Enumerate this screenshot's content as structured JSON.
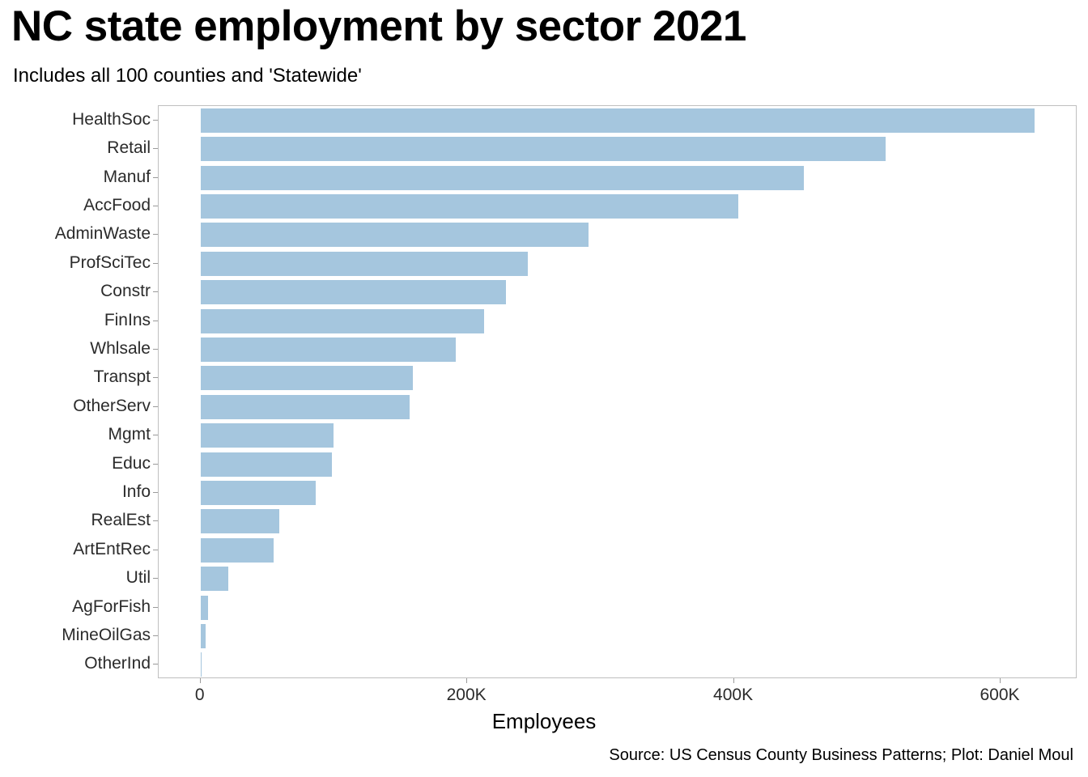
{
  "header": {
    "title": "NC state employment by sector 2021",
    "subtitle": "Includes all 100 counties and 'Statewide'"
  },
  "footer": {
    "caption": "Source: US Census County Business Patterns; Plot: Daniel Moul"
  },
  "axes": {
    "x_title": "Employees",
    "x_ticks": [
      {
        "label": "0",
        "value": 0
      },
      {
        "label": "200K",
        "value": 200000
      },
      {
        "label": "400K",
        "value": 400000
      },
      {
        "label": "600K",
        "value": 600000
      }
    ]
  },
  "style": {
    "bar_color": "#a5c6de",
    "panel_border": "#bfbfbf",
    "axis_text": "#2b2b2b",
    "background": "#ffffff"
  },
  "chart_data": {
    "type": "bar",
    "orientation": "horizontal",
    "title": "NC state employment by sector 2021",
    "subtitle": "Includes all 100 counties and 'Statewide'",
    "xlabel": "Employees",
    "ylabel": "",
    "xlim": [
      0,
      640000
    ],
    "grid": false,
    "legend": null,
    "categories": [
      "HealthSoc",
      "Retail",
      "Manuf",
      "AccFood",
      "AdminWaste",
      "ProfSciTec",
      "Constr",
      "FinIns",
      "Whlsale",
      "Transpt",
      "OtherServ",
      "Mgmt",
      "Educ",
      "Info",
      "RealEst",
      "ArtEntRec",
      "Util",
      "AgForFish",
      "MineOilGas",
      "OtherInd"
    ],
    "values": [
      625300,
      513600,
      452500,
      403100,
      291000,
      245400,
      228800,
      212600,
      191400,
      159200,
      156800,
      99800,
      98300,
      86100,
      58800,
      54800,
      20600,
      5700,
      4000,
      900
    ]
  }
}
